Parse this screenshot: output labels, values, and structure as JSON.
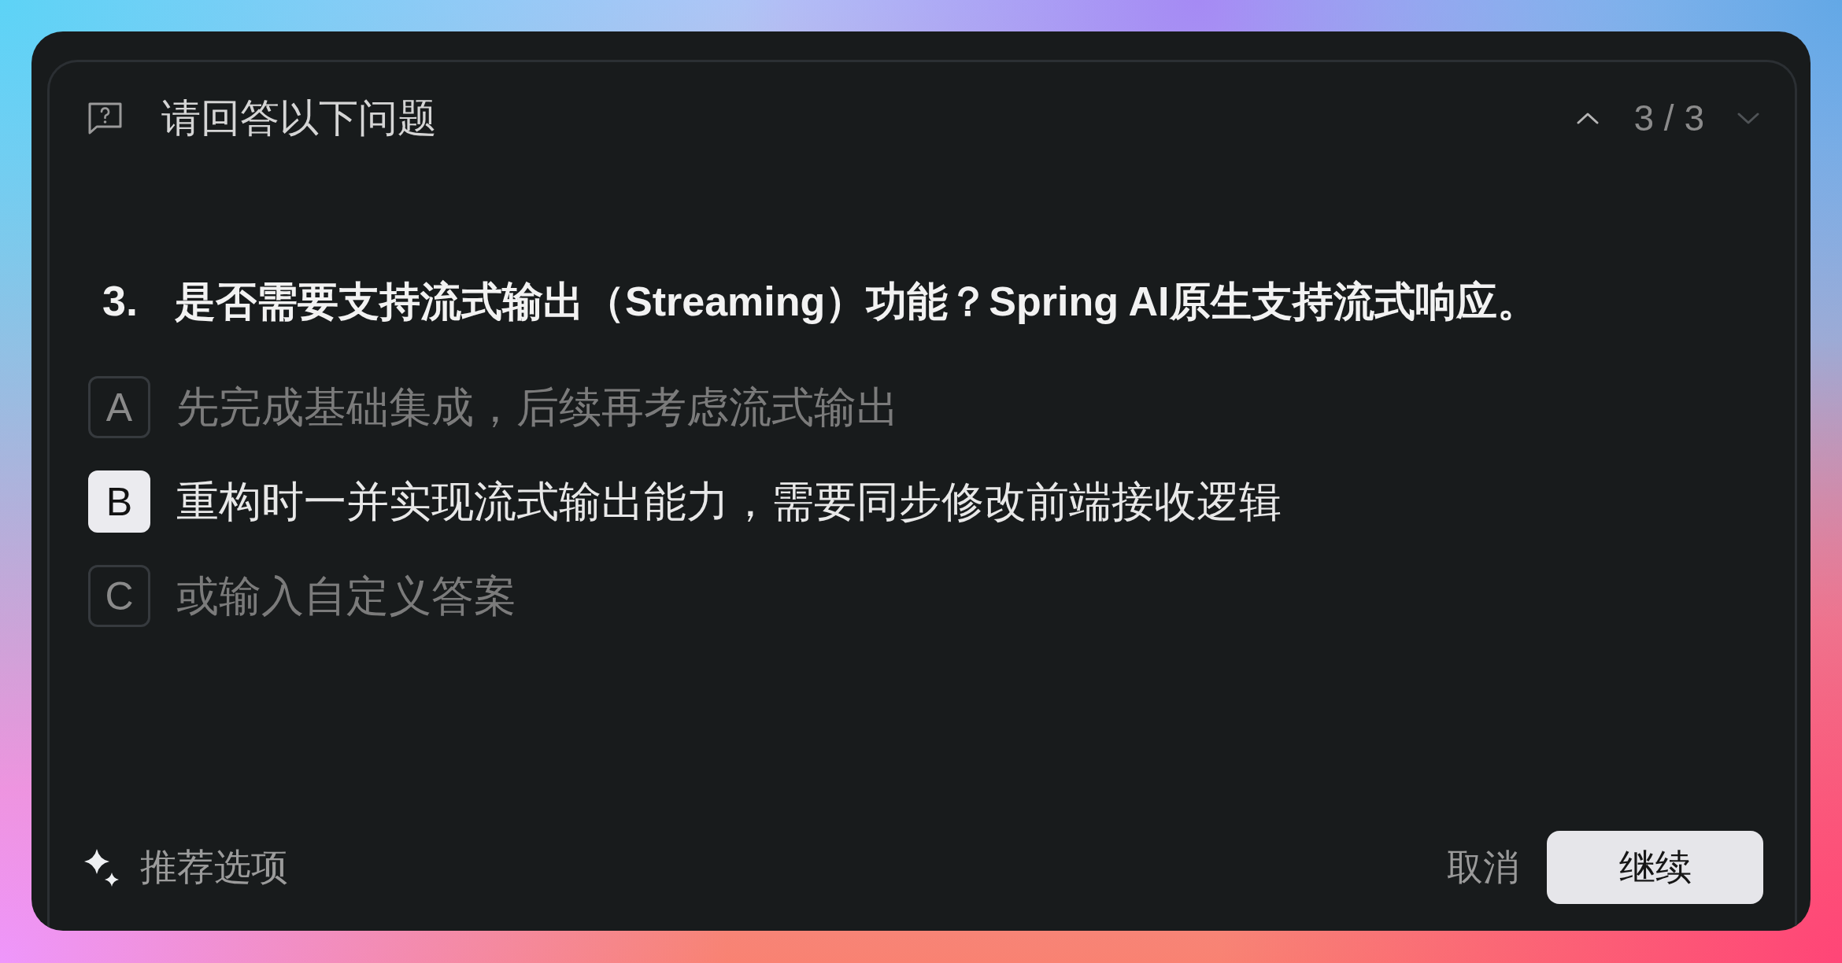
{
  "header": {
    "title": "请回答以下问题",
    "pager": {
      "text": "3 / 3",
      "prev_disabled": false,
      "next_disabled": true
    }
  },
  "question": {
    "number": "3.",
    "text": "是否需要支持流式输出（Streaming）功能？Spring AI原生支持流式响应。"
  },
  "options": [
    {
      "key": "A",
      "label": "先完成基础集成，后续再考虑流式输出",
      "selected": false
    },
    {
      "key": "B",
      "label": "重构时一并实现流式输出能力，需要同步修改前端接收逻辑",
      "selected": true
    },
    {
      "key": "C",
      "label": "或输入自定义答案",
      "selected": false
    }
  ],
  "footer": {
    "recommend": "推荐选项",
    "buttons": [
      {
        "label": "取消",
        "kind": "secondary"
      },
      {
        "label": "继续",
        "kind": "primary"
      }
    ]
  }
}
